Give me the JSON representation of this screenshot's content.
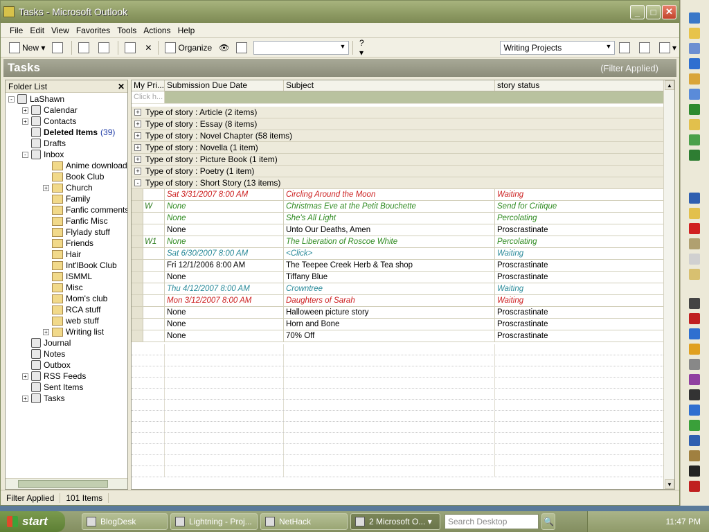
{
  "window": {
    "title": "Tasks - Microsoft Outlook"
  },
  "menu": [
    "File",
    "Edit",
    "View",
    "Favorites",
    "Tools",
    "Actions",
    "Help"
  ],
  "toolbar": {
    "new_label": "New",
    "organize_label": "Organize",
    "view_combo": "Writing Projects"
  },
  "band": {
    "title": "Tasks",
    "filter_text": "(Filter Applied)"
  },
  "folder_pane": {
    "title": "Folder List",
    "items": [
      {
        "label": "LaShawn",
        "level": 0,
        "exp": "-"
      },
      {
        "label": "Calendar",
        "level": 1,
        "exp": "+"
      },
      {
        "label": "Contacts",
        "level": 1,
        "exp": "+"
      },
      {
        "label": "Deleted Items",
        "level": 1,
        "exp": "",
        "bold": true,
        "count": "(39)"
      },
      {
        "label": "Drafts",
        "level": 1,
        "exp": ""
      },
      {
        "label": "Inbox",
        "level": 1,
        "exp": "-"
      },
      {
        "label": "Anime downloads",
        "level": 2,
        "exp": ""
      },
      {
        "label": "Book Club",
        "level": 2,
        "exp": ""
      },
      {
        "label": "Church",
        "level": 2,
        "exp": "+"
      },
      {
        "label": "Family",
        "level": 2,
        "exp": ""
      },
      {
        "label": "Fanfic comments",
        "level": 2,
        "exp": ""
      },
      {
        "label": "Fanfic Misc",
        "level": 2,
        "exp": ""
      },
      {
        "label": "Flylady stuff",
        "level": 2,
        "exp": ""
      },
      {
        "label": "Friends",
        "level": 2,
        "exp": ""
      },
      {
        "label": "Hair",
        "level": 2,
        "exp": ""
      },
      {
        "label": "Int'lBook Club",
        "level": 2,
        "exp": ""
      },
      {
        "label": "ISMML",
        "level": 2,
        "exp": ""
      },
      {
        "label": "Misc",
        "level": 2,
        "exp": ""
      },
      {
        "label": "Mom's club",
        "level": 2,
        "exp": ""
      },
      {
        "label": "RCA stuff",
        "level": 2,
        "exp": ""
      },
      {
        "label": "web stuff",
        "level": 2,
        "exp": ""
      },
      {
        "label": "Writing list",
        "level": 2,
        "exp": "+"
      },
      {
        "label": "Journal",
        "level": 1,
        "exp": ""
      },
      {
        "label": "Notes",
        "level": 1,
        "exp": ""
      },
      {
        "label": "Outbox",
        "level": 1,
        "exp": ""
      },
      {
        "label": "RSS Feeds",
        "level": 1,
        "exp": "+"
      },
      {
        "label": "Sent Items",
        "level": 1,
        "exp": ""
      },
      {
        "label": "Tasks",
        "level": 1,
        "exp": "+"
      }
    ]
  },
  "grid": {
    "headers": [
      "My Pri...",
      "Submission Due Date",
      "Subject",
      "story status"
    ],
    "click_hint": "Click h...",
    "groups": [
      {
        "label": "Type of story : Article (2 items)",
        "exp": "+"
      },
      {
        "label": "Type of story : Essay (8 items)",
        "exp": "+"
      },
      {
        "label": "Type of story : Novel Chapter (58 items)",
        "exp": "+"
      },
      {
        "label": "Type of story : Novella (1 item)",
        "exp": "+"
      },
      {
        "label": "Type of story : Picture Book (1 item)",
        "exp": "+"
      },
      {
        "label": "Type of story : Poetry (1 item)",
        "exp": "+"
      },
      {
        "label": "Type of story : Short Story (13 items)",
        "exp": "-"
      }
    ],
    "rows": [
      {
        "pri": "",
        "date": "Sat 3/31/2007 8:00 AM",
        "subject": "Circling Around the Moon",
        "status": "Waiting",
        "style": "red"
      },
      {
        "pri": "W",
        "date": "None",
        "subject": "Christmas Eve at the Petit Bouchette",
        "status": "Send for Critique",
        "style": "green"
      },
      {
        "pri": "",
        "date": "None",
        "subject": "She's All Light",
        "status": "Percolating",
        "style": "green"
      },
      {
        "pri": "",
        "date": "None",
        "subject": "Unto Our Deaths, Amen",
        "status": "Proscrastinate",
        "style": "plain"
      },
      {
        "pri": "W1",
        "date": "None",
        "subject": "The Liberation of Roscoe White",
        "status": "Percolating",
        "style": "green"
      },
      {
        "pri": "",
        "date": "Sat 6/30/2007 8:00 AM",
        "subject": "<Click>",
        "status": "Waiting",
        "style": "teal"
      },
      {
        "pri": "",
        "date": "Fri 12/1/2006 8:00 AM",
        "subject": "The Teepee Creek Herb & Tea shop",
        "status": "Proscrastinate",
        "style": "plain"
      },
      {
        "pri": "",
        "date": "None",
        "subject": "Tiffany Blue",
        "status": "Proscrastinate",
        "style": "plain"
      },
      {
        "pri": "",
        "date": "Thu 4/12/2007 8:00 AM",
        "subject": "Crowntree",
        "status": "Waiting",
        "style": "teal"
      },
      {
        "pri": "",
        "date": "Mon 3/12/2007 8:00 AM",
        "subject": "Daughters of Sarah",
        "status": "Waiting",
        "style": "red"
      },
      {
        "pri": "",
        "date": "None",
        "subject": "Halloween picture story",
        "status": "Proscrastinate",
        "style": "plain"
      },
      {
        "pri": "",
        "date": "None",
        "subject": "Horn and Bone",
        "status": "Proscrastinate",
        "style": "plain"
      },
      {
        "pri": "",
        "date": "None",
        "subject": "70% Off",
        "status": "Proscrastinate",
        "style": "plain"
      }
    ]
  },
  "status": {
    "filter": "Filter Applied",
    "count": "101 Items"
  },
  "taskbar": {
    "start": "start",
    "items": [
      {
        "label": "BlogDesk",
        "active": false
      },
      {
        "label": "Lightning - Proj...",
        "active": false
      },
      {
        "label": "NetHack",
        "active": false
      },
      {
        "label": "2 Microsoft O...",
        "active": true
      }
    ],
    "search_placeholder": "Search Desktop",
    "clock": "11:47 PM"
  },
  "colors": {
    "title_bar": "#8d9a63",
    "red_text": "#cc1f1f",
    "green_text": "#2e8a1f",
    "teal_text": "#2a8a99"
  }
}
